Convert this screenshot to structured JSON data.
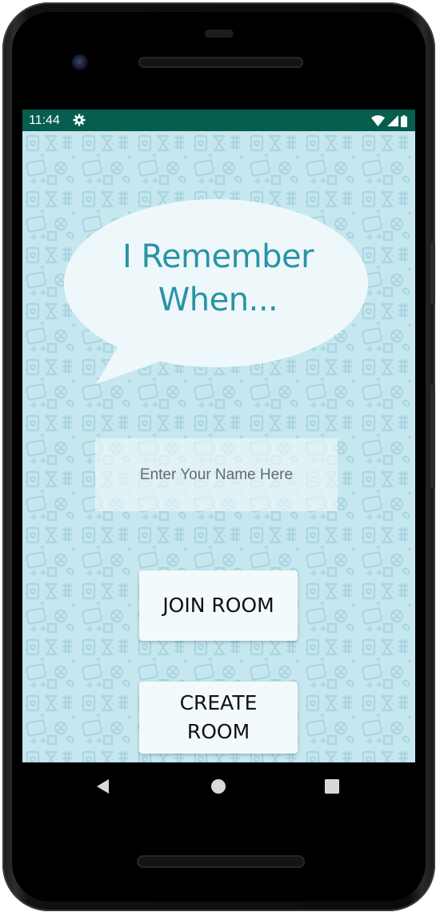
{
  "status_bar": {
    "time": "11:44",
    "icons": [
      "settings-gear-icon",
      "wifi-icon",
      "cellular-signal-icon",
      "battery-icon"
    ],
    "background_color": "#075e4f"
  },
  "app": {
    "title_line1": "I Remember",
    "title_line2": "When...",
    "title_color": "#2a93a5",
    "background_color": "#c6e7ef",
    "name_input": {
      "placeholder": "Enter Your Name Here",
      "value": ""
    },
    "join_button_label": "JOIN ROOM",
    "create_button_label": "CREATE\nROOM"
  },
  "navigation": {
    "buttons": [
      "back-icon",
      "home-icon",
      "recents-icon"
    ]
  }
}
